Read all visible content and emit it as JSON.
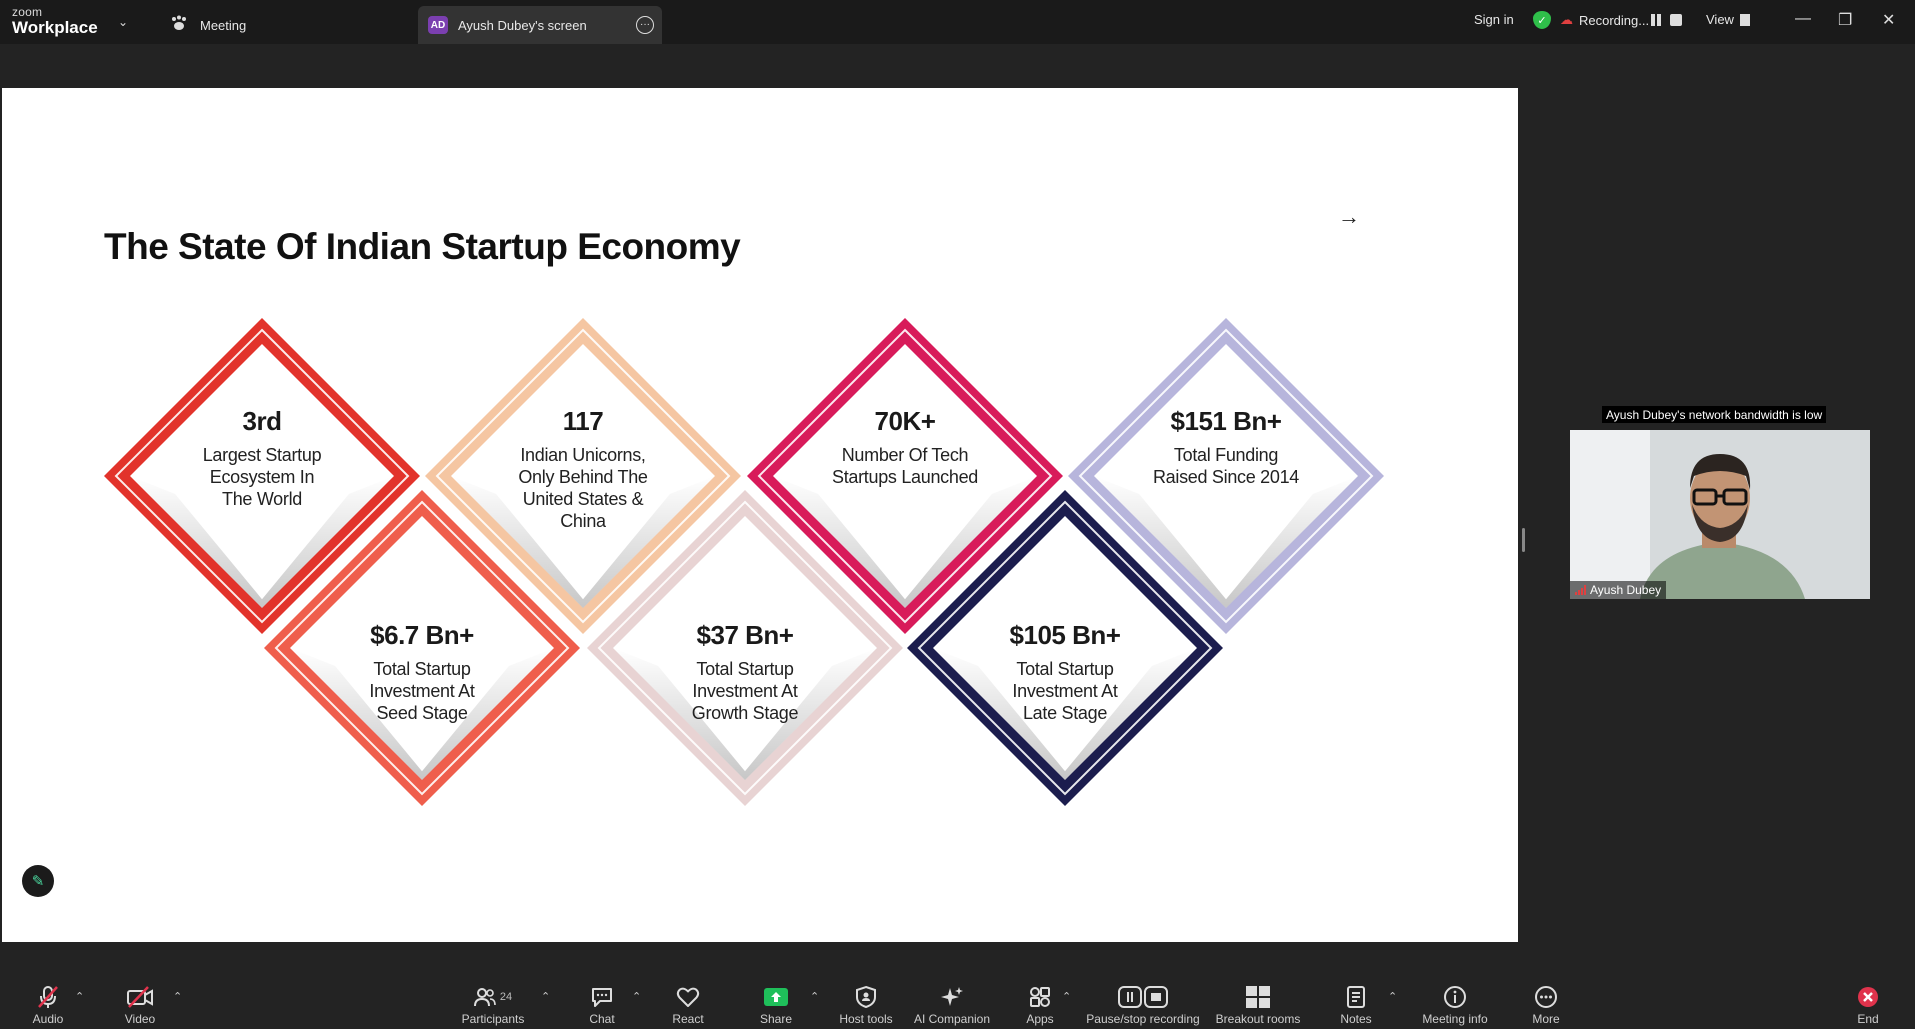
{
  "titlebar": {
    "brand_small": "zoom",
    "brand_large": "Workplace",
    "meeting_tab": "Meeting",
    "screen_tab_initials": "AD",
    "screen_tab_label": "Ayush Dubey's screen",
    "sign_in": "Sign in",
    "recording": "Recording...",
    "view": "View"
  },
  "slide": {
    "title": "The State Of Indian Startup Economy",
    "top_stats": [
      {
        "value": "3rd",
        "label_lines": [
          "Largest Startup",
          "Ecosystem In",
          "The World"
        ]
      },
      {
        "value": "117",
        "label_lines": [
          "Indian Unicorns,",
          "Only Behind The",
          "United States &",
          "China"
        ]
      },
      {
        "value": "70K+",
        "label_lines": [
          "Number Of Tech",
          "Startups Launched"
        ]
      },
      {
        "value": "$151 Bn+",
        "label_lines": [
          "Total Funding",
          "Raised Since 2014"
        ]
      }
    ],
    "bottom_stats": [
      {
        "value": "$6.7 Bn+",
        "label_lines": [
          "Total Startup",
          "Investment At",
          "Seed Stage"
        ]
      },
      {
        "value": "$37 Bn+",
        "label_lines": [
          "Total Startup",
          "Investment At",
          "Growth Stage"
        ]
      },
      {
        "value": "$105 Bn+",
        "label_lines": [
          "Total Startup",
          "Investment At",
          "Late Stage"
        ]
      }
    ],
    "colors": {
      "top": [
        "#e2332b",
        "#f5c6a2",
        "#d81b5a",
        "#b7b5dc"
      ],
      "bottom": [
        "#ef5e4c",
        "#e8d3d3",
        "#1c1d4e"
      ]
    }
  },
  "participant": {
    "bandwidth_notice": "Ayush Dubey's network bandwidth is low",
    "name": "Ayush Dubey"
  },
  "toolbar": {
    "audio": "Audio",
    "video": "Video",
    "participants": "Participants",
    "participant_count": "24",
    "chat": "Chat",
    "react": "React",
    "share": "Share",
    "host_tools": "Host tools",
    "ai_companion": "AI Companion",
    "apps": "Apps",
    "pause_stop_recording": "Pause/stop recording",
    "breakout_rooms": "Breakout rooms",
    "notes": "Notes",
    "meeting_info": "Meeting info",
    "more": "More",
    "end": "End"
  }
}
